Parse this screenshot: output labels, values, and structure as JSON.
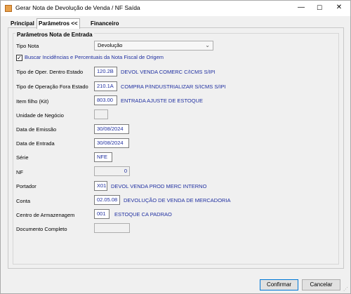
{
  "window": {
    "title": "Gerar Nota de Devolução de Venda / NF Saída",
    "icon": "app-icon",
    "controls": {
      "minimize": "—",
      "maximize": "☐",
      "close": "✕"
    }
  },
  "tabs": [
    {
      "label": "Principal"
    },
    {
      "label": "Parâmetros <<"
    },
    {
      "label": "Financeiro"
    }
  ],
  "group": {
    "title": "Parâmetros Nota de Entrada"
  },
  "tipo_nota": {
    "label": "Tipo Nota",
    "value": "Devolução",
    "arrow": "⌄"
  },
  "buscar": {
    "label": "Buscar Incidências e Percentuais da Nota Fiscal de Origem",
    "checked": true,
    "mark": "✓"
  },
  "fields": {
    "oper_dentro": {
      "label": "Tipo de Oper. Dentro Estado",
      "value": "120.2B",
      "desc": "DEVOL VENDA COMERC C/ICMS S/IPI"
    },
    "oper_fora": {
      "label": "Tipo de Operação Fora Estado",
      "value": "210.1A",
      "desc": "COMPRA P/INDUSTRIALIZAR S/ICMS S/IPI"
    },
    "item_filho": {
      "label": "Item filho (Kit)",
      "value": "803.00",
      "desc": "ENTRADA AJUSTE DE ESTOQUE"
    },
    "unidade": {
      "label": "Unidade de Negócio",
      "value": ""
    },
    "emissao": {
      "label": "Data de Emissão",
      "value": "30/08/2024"
    },
    "entrada": {
      "label": "Data de Entrada",
      "value": "30/08/2024"
    },
    "serie": {
      "label": "Série",
      "value": "NFE"
    },
    "nf": {
      "label": "NF",
      "value": "0"
    },
    "portador": {
      "label": "Portador",
      "value": "X01",
      "desc": "DEVOL VENDA PROD MERC INTERNO"
    },
    "conta": {
      "label": "Conta",
      "value": "02.05.08",
      "desc": "DEVOLUÇÃO DE VENDA DE MERCADORIA"
    },
    "centro": {
      "label": "Centro de Armazenagem",
      "value": "001",
      "desc": "ESTOQUE CA PADRAO"
    },
    "doc_completo": {
      "label": "Documento Completo",
      "value": ""
    }
  },
  "buttons": {
    "confirm": "Confirmar",
    "cancel": "Cancelar"
  },
  "colors": {
    "link_text": "#1f2fa0",
    "primary_border": "#0078d7"
  }
}
